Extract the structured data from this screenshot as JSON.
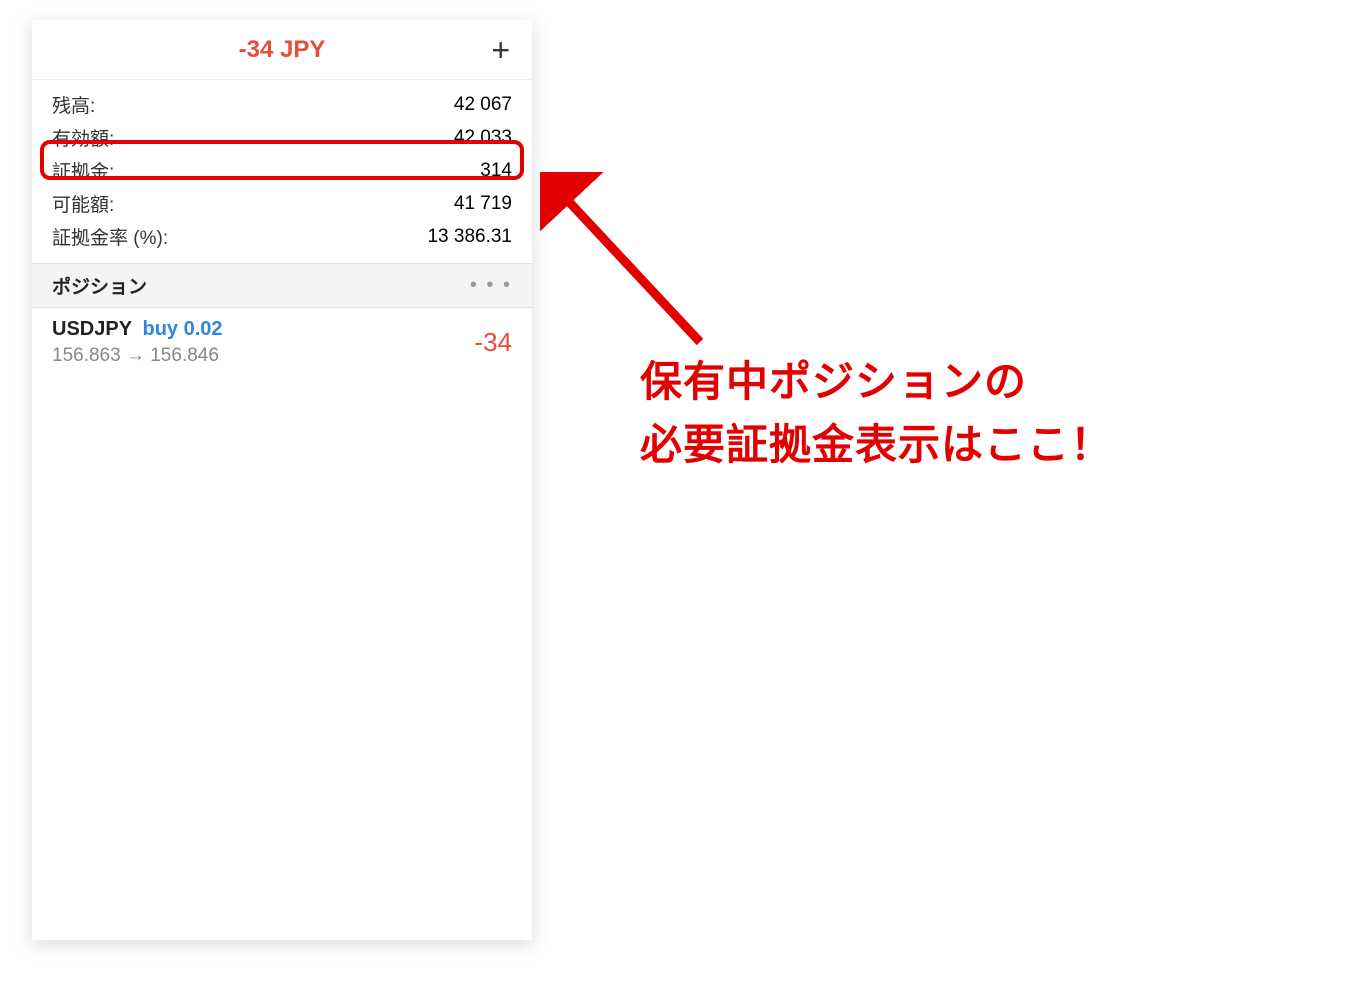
{
  "header": {
    "title": "-34 JPY",
    "plus": "+"
  },
  "account": {
    "rows": [
      {
        "label": "残高:",
        "value": "42 067"
      },
      {
        "label": "有効額:",
        "value": "42 033"
      },
      {
        "label": "証拠金:",
        "value": "314"
      },
      {
        "label": "可能額:",
        "value": "41 719"
      },
      {
        "label": "証拠金率 (%):",
        "value": "13 386.31"
      }
    ]
  },
  "positions": {
    "header": "ポジション",
    "dots": "• • •",
    "items": [
      {
        "symbol": "USDJPY",
        "action": "buy 0.02",
        "prices": "156.863 → 156.846",
        "pl": "-34"
      }
    ]
  },
  "annotation": {
    "line1": "保有中ポジションの",
    "line2": "必要証拠金表示はここ！"
  }
}
